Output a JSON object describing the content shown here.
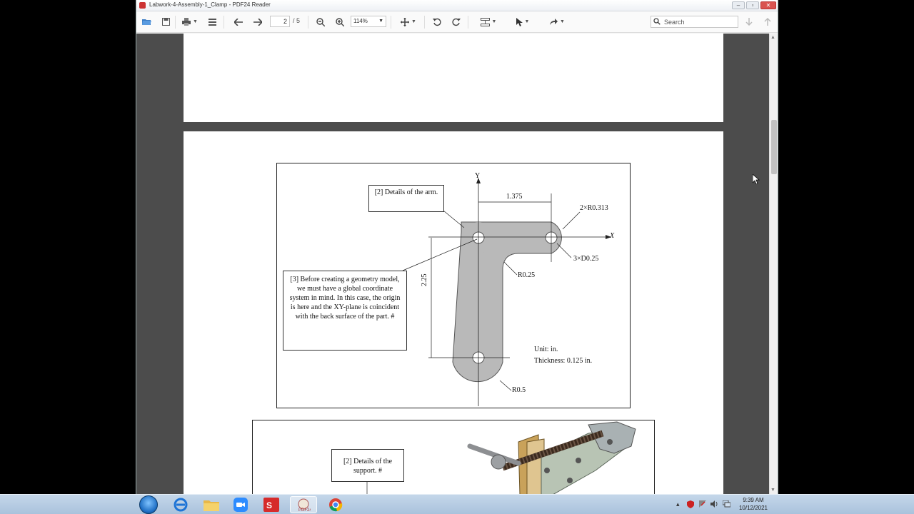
{
  "window": {
    "title": "Labwork-4-Assembly-1_Clamp - PDF24 Reader",
    "minimize": "–",
    "maximize": "▫",
    "close": "✕"
  },
  "toolbar": {
    "page_current": "2",
    "page_total": "/  5",
    "zoom": "114%",
    "search_placeholder": "Search"
  },
  "document": {
    "figure1": {
      "callout_arm": "[2] Details of the arm.",
      "callout_origin": "[3] Before creating a geometry model, we must have a global coordinate system in mind.  In this case, the origin is here and the XY-plane is coincident with the back surface of the part. #",
      "axis_y": "Y",
      "axis_x": "X",
      "dim_width": "1.375",
      "dim_height": "2.25",
      "label_outer_radius": "2×R0.313",
      "label_holes": "3×D0.25",
      "label_fillet": "R0.25",
      "label_bottom_radius": "R0.5",
      "unit": "Unit: in.",
      "thickness": "Thickness: 0.125 in."
    },
    "figure2": {
      "callout_support": "[2] Details of the support. #"
    }
  },
  "taskbar": {
    "clock_time": "9:39 AM",
    "clock_date": "10/12/2021"
  }
}
